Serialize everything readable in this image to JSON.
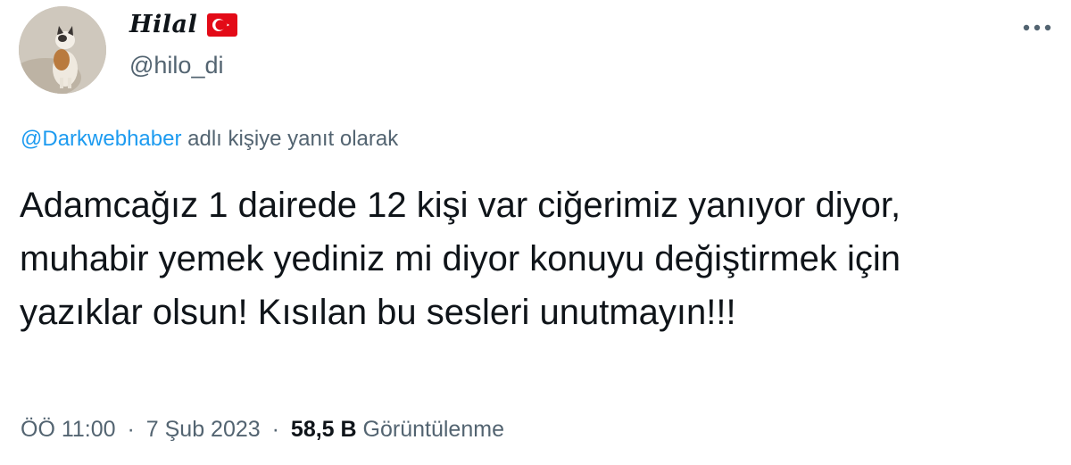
{
  "author": {
    "display_name": "Hilal",
    "handle": "@hilo_di",
    "flag_icon": "turkey-flag-icon",
    "avatar": "cat-photo-avatar"
  },
  "more_icon": "more-options-icon",
  "reply": {
    "mention": "@Darkwebhaber",
    "suffix": "adlı kişiye yanıt olarak"
  },
  "tweet_text": "Adamcağız 1 dairede 12 kişi var ciğerimiz yanıyor diyor, muhabir yemek yediniz mi diyor konuyu değiştirmek için yazıklar olsun! Kısılan bu sesleri unutmayın!!!",
  "meta": {
    "time": "ÖÖ 11:00",
    "separator": "·",
    "date": "7 Şub 2023",
    "views_count": "58,5 B",
    "views_label": "Görüntülenme"
  },
  "colors": {
    "text": "#0f1419",
    "secondary": "#536471",
    "link": "#1d9bf0",
    "flag_red": "#e30a17"
  }
}
